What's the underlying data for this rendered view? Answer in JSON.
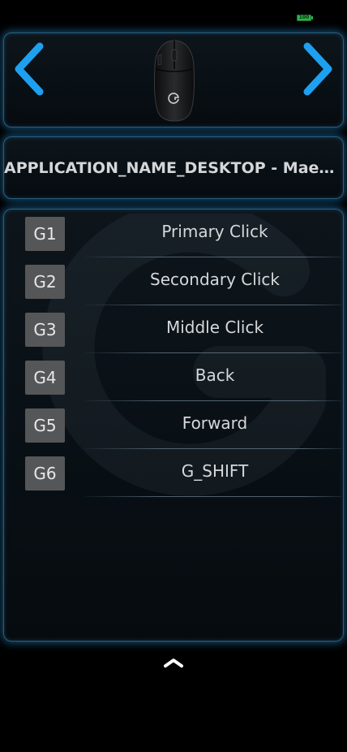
{
  "status_bar": {
    "battery_level": "100",
    "battery_color": "#2db34a"
  },
  "device": {
    "prev_icon": "chevron-left-icon",
    "next_icon": "chevron-right-icon",
    "image_icon": "gaming-mouse-icon",
    "accent_color": "#1ea0f0"
  },
  "profile": {
    "app_name": "APPLICATION_NAME_DESKTOP - Maez..."
  },
  "bindings": [
    {
      "key": "G1",
      "action": "Primary Click"
    },
    {
      "key": "G2",
      "action": "Secondary Click"
    },
    {
      "key": "G3",
      "action": "Middle Click"
    },
    {
      "key": "G4",
      "action": "Back"
    },
    {
      "key": "G5",
      "action": "Forward"
    },
    {
      "key": "G6",
      "action": "G_SHIFT"
    }
  ],
  "footer": {
    "collapse_icon": "chevron-up-icon"
  }
}
